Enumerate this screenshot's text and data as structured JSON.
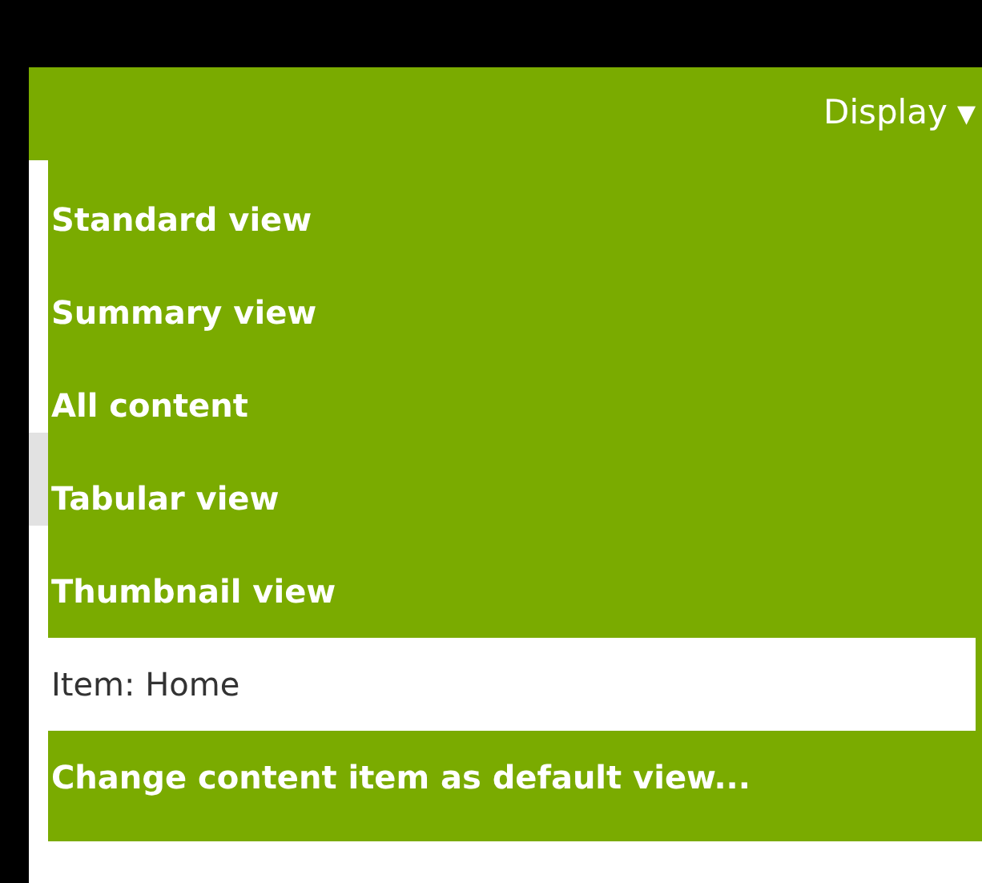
{
  "menu_button": {
    "label": "Display",
    "caret": "▼"
  },
  "menu_items": [
    {
      "label": "Standard view",
      "selected": false
    },
    {
      "label": "Summary view",
      "selected": false
    },
    {
      "label": "All content",
      "selected": false
    },
    {
      "label": "Tabular view",
      "selected": false
    },
    {
      "label": "Thumbnail view",
      "selected": false
    },
    {
      "label": "Item: Home",
      "selected": true
    },
    {
      "label": "Change content item as default view...",
      "selected": false
    }
  ]
}
